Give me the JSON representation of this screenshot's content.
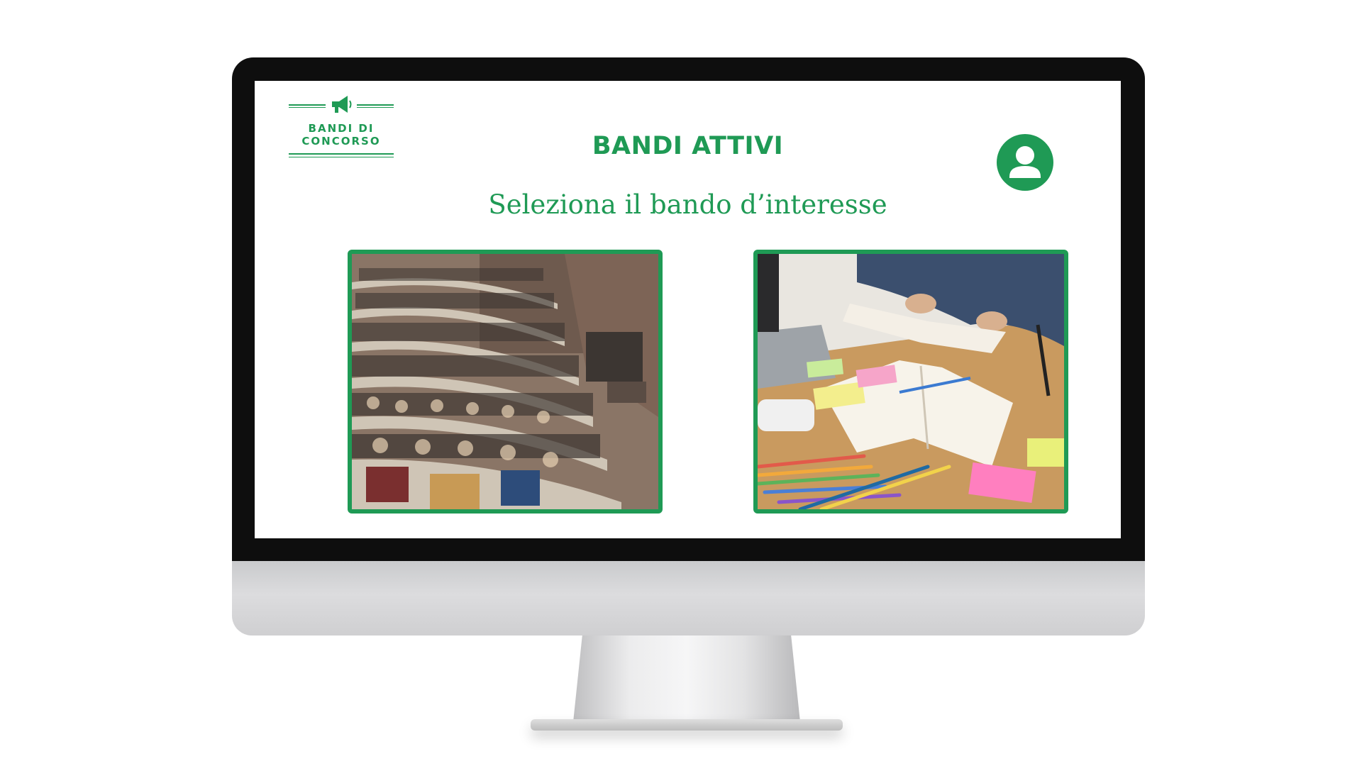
{
  "brand": {
    "logo_text_line1": "BANDI DI",
    "logo_text_line2": "CONCORSO",
    "icon": "megaphone-icon",
    "accent_color": "#1f9a55"
  },
  "header": {
    "title": "BANDI ATTIVI",
    "subtitle": "Seleziona il bando d’interesse",
    "user_icon": "user-avatar-icon"
  },
  "cards": [
    {
      "image": "lecture-hall-students-photo"
    },
    {
      "image": "open-books-study-desk-photo"
    }
  ]
}
